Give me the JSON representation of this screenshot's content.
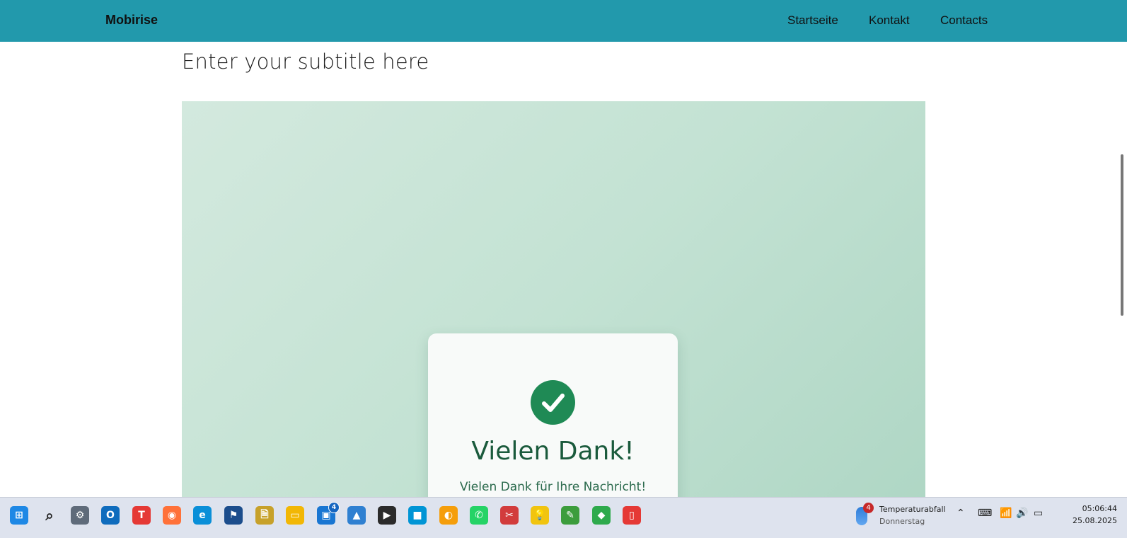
{
  "nav": {
    "brand": "Mobirise",
    "links": [
      "Startseite",
      "Kontakt",
      "Contacts"
    ],
    "bar_color": "#2299ac"
  },
  "page": {
    "subtitle": "Enter your subtitle here"
  },
  "card": {
    "icon": "check-circle-icon",
    "title": "Vielen Dank!",
    "text": "Vielen Dank für Ihre Nachricht!",
    "accent": "#1f8a55"
  },
  "taskbar": {
    "apps": [
      {
        "name": "start-icon",
        "glyph": "⊞",
        "color": "#1e88e5"
      },
      {
        "name": "search-icon",
        "glyph": "⌕",
        "color": "#333333"
      },
      {
        "name": "settings-icon",
        "glyph": "⚙",
        "color": "#5f6b7a"
      },
      {
        "name": "outlook-icon",
        "glyph": "O",
        "color": "#0f6cbd"
      },
      {
        "name": "todo-app-icon",
        "glyph": "T",
        "color": "#e53935"
      },
      {
        "name": "firefox-icon",
        "glyph": "◉",
        "color": "#ff7139"
      },
      {
        "name": "edge-icon",
        "glyph": "e",
        "color": "#0a8fd8"
      },
      {
        "name": "vpn-icon",
        "glyph": "⚑",
        "color": "#1c4d8c"
      },
      {
        "name": "file-search-icon",
        "glyph": "🗎",
        "color": "#c7a12a"
      },
      {
        "name": "file-explorer-icon",
        "glyph": "▭",
        "color": "#f2b705"
      },
      {
        "name": "remote-desktop-icon",
        "glyph": "▣",
        "color": "#1976d2",
        "badge": "4"
      },
      {
        "name": "photos-icon",
        "glyph": "▲",
        "color": "#2f80d1"
      },
      {
        "name": "media-player-icon",
        "glyph": "▶",
        "color": "#2b2b2b"
      },
      {
        "name": "meet-icon",
        "glyph": "■",
        "color": "#0095d5"
      },
      {
        "name": "pie-app-icon",
        "glyph": "◐",
        "color": "#f59e0b"
      },
      {
        "name": "whatsapp-icon",
        "glyph": "✆",
        "color": "#25d366"
      },
      {
        "name": "snipping-tool-icon",
        "glyph": "✂",
        "color": "#d23c3c"
      },
      {
        "name": "tips-icon",
        "glyph": "💡",
        "color": "#f1c40f"
      },
      {
        "name": "editor-icon",
        "glyph": "✎",
        "color": "#3c9d3c"
      },
      {
        "name": "cube-app-icon",
        "glyph": "◆",
        "color": "#2eaa4c"
      },
      {
        "name": "phone-link-icon",
        "glyph": "▯",
        "color": "#e53935"
      }
    ],
    "weather": {
      "badge": "4",
      "title": "Temperaturabfall",
      "subtitle": "Donnerstag"
    },
    "tray": {
      "chevron": "⌃",
      "keyboard": "⌨",
      "wifi": "📶",
      "volume": "🔊",
      "battery": "▭"
    },
    "clock": {
      "time": "05:06:44",
      "date": "25.08.2025"
    }
  }
}
